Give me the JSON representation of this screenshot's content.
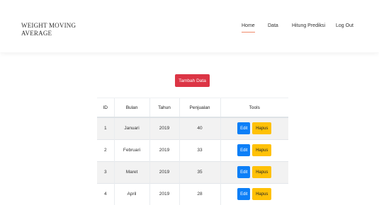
{
  "brand": {
    "line1": "WEIGHT MOVING",
    "line2": "AVERAGE"
  },
  "nav": {
    "items": [
      {
        "label": "Home",
        "active": true
      },
      {
        "label": "Data",
        "active": false
      },
      {
        "label": "Hitung Prediksi",
        "active": false
      },
      {
        "label": "Log Out",
        "active": false
      }
    ]
  },
  "actions": {
    "add_label": "Tambah Data"
  },
  "table": {
    "headers": [
      "ID",
      "Bulan",
      "Tahun",
      "Penjualan",
      "Tools"
    ],
    "rows": [
      {
        "id": "1",
        "bulan": "Januari",
        "tahun": "2019",
        "penjualan": "40"
      },
      {
        "id": "2",
        "bulan": "Februari",
        "tahun": "2019",
        "penjualan": "33"
      },
      {
        "id": "3",
        "bulan": "Maret",
        "tahun": "2019",
        "penjualan": "35"
      },
      {
        "id": "4",
        "bulan": "April",
        "tahun": "2019",
        "penjualan": "28"
      }
    ],
    "edit_label": "Edit",
    "delete_label": "Hapus"
  },
  "colors": {
    "add_button": "#dc3545",
    "edit_button": "#0d7ff7",
    "delete_button": "#ffc107",
    "active_underline": "#f08a6a"
  }
}
